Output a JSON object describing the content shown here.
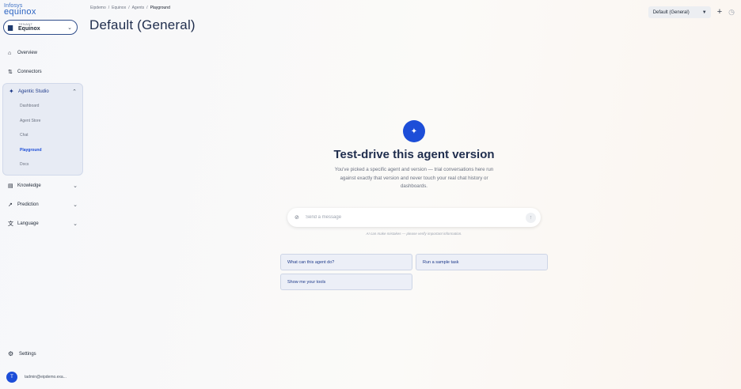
{
  "brand": {
    "line1": "Infosys",
    "line2": "equinox"
  },
  "tenant": {
    "caption": "TENANT",
    "value": "Equinox"
  },
  "nav": {
    "overview": "Overview",
    "connectors": "Connectors",
    "agentic_studio": "Agentic Studio",
    "studio_items": [
      "Dashboard",
      "Agent Store",
      "Chat",
      "Playground",
      "Docs"
    ],
    "knowledge": "Knowledge",
    "prediction": "Prediction",
    "language": "Language",
    "settings": "Settings"
  },
  "user": {
    "initial": "T",
    "email": "tadmin@eipdemo.exa..."
  },
  "breadcrumb": [
    "Eipdemo",
    "Equinox",
    "Agents",
    "Playground"
  ],
  "page_title": "Default (General)",
  "version_select": "Default (General)",
  "hero": {
    "title": "Test-drive this agent version",
    "subtitle": "You've picked a specific agent and version — trial conversations here run against exactly that version and never touch your real chat history or dashboards."
  },
  "composer": {
    "placeholder": "Send a message",
    "disclaimer": "AI can make mistakes — please verify important information."
  },
  "suggestions": [
    "What can this agent do?",
    "Run a sample task",
    "Show me your tools"
  ],
  "colors": {
    "accent": "#1d4ed8",
    "title": "#1f2d4d"
  }
}
